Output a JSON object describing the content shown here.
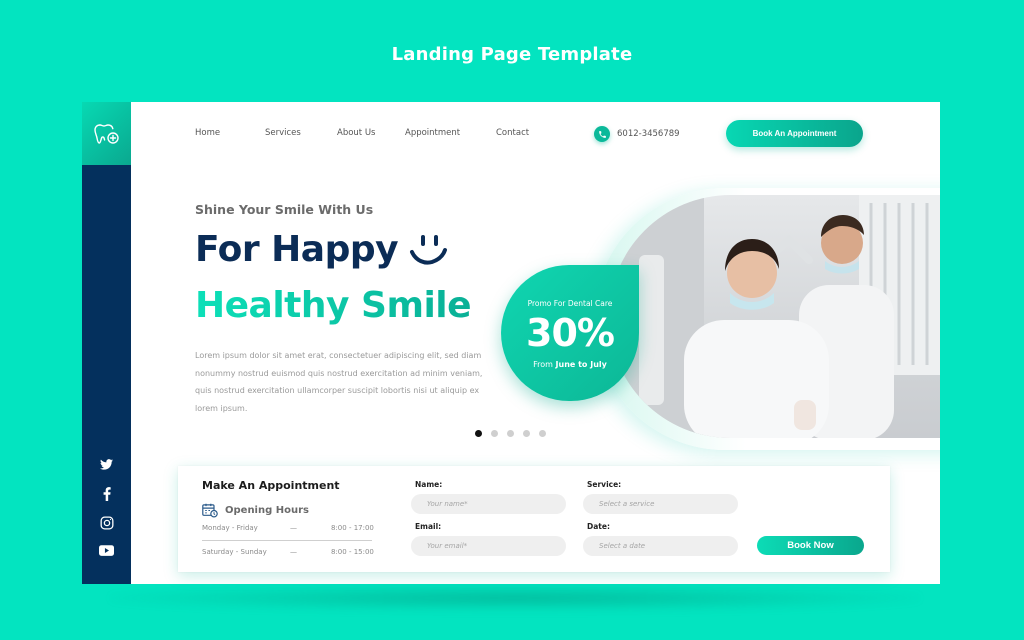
{
  "page": {
    "title": "Landing Page Template"
  },
  "nav": {
    "items": [
      "Home",
      "Services",
      "About Us",
      "Appointment",
      "Contact"
    ],
    "phone": "6012-3456789",
    "book_button": "Book An Appointment"
  },
  "hero": {
    "tagline": "Shine Your Smile With Us",
    "headline_line1": "For Happy",
    "headline_line2": "Healthy Smile",
    "description": "Lorem ipsum dolor sit amet erat, consectetuer adipiscing elit, sed diam nonummy nostrud euismod quis nostrud exercitation ad minim veniam, quis nostrud exercitation ullamcorper suscipit lobortis nisi ut aliquip ex lorem ipsum.",
    "slider": {
      "total": 5,
      "active_index": 0
    }
  },
  "promo": {
    "label": "Promo For Dental Care",
    "discount": "30%",
    "date_prefix": "From",
    "date_range": "June to July"
  },
  "appointment": {
    "title": "Make An Appointment",
    "opening_hours_title": "Opening Hours",
    "hours": [
      {
        "days": "Monday - Friday",
        "sep": "—",
        "time": "8:00 - 17:00"
      },
      {
        "days": "Saturday - Sunday",
        "sep": "—",
        "time": "8:00 - 15:00"
      }
    ],
    "fields": {
      "name": {
        "label": "Name:",
        "placeholder": "Your name*"
      },
      "email": {
        "label": "Email:",
        "placeholder": "Your email*"
      },
      "service": {
        "label": "Service:",
        "placeholder": "Select a service"
      },
      "date": {
        "label": "Date:",
        "placeholder": "Select a date"
      }
    },
    "book_now": "Book Now"
  },
  "social": [
    "twitter-icon",
    "facebook-icon",
    "instagram-icon",
    "youtube-icon"
  ],
  "colors": {
    "background": "#03e4c0",
    "navy": "#04305d",
    "accent": "#0bb99a",
    "headline_dark": "#0b2c56"
  }
}
